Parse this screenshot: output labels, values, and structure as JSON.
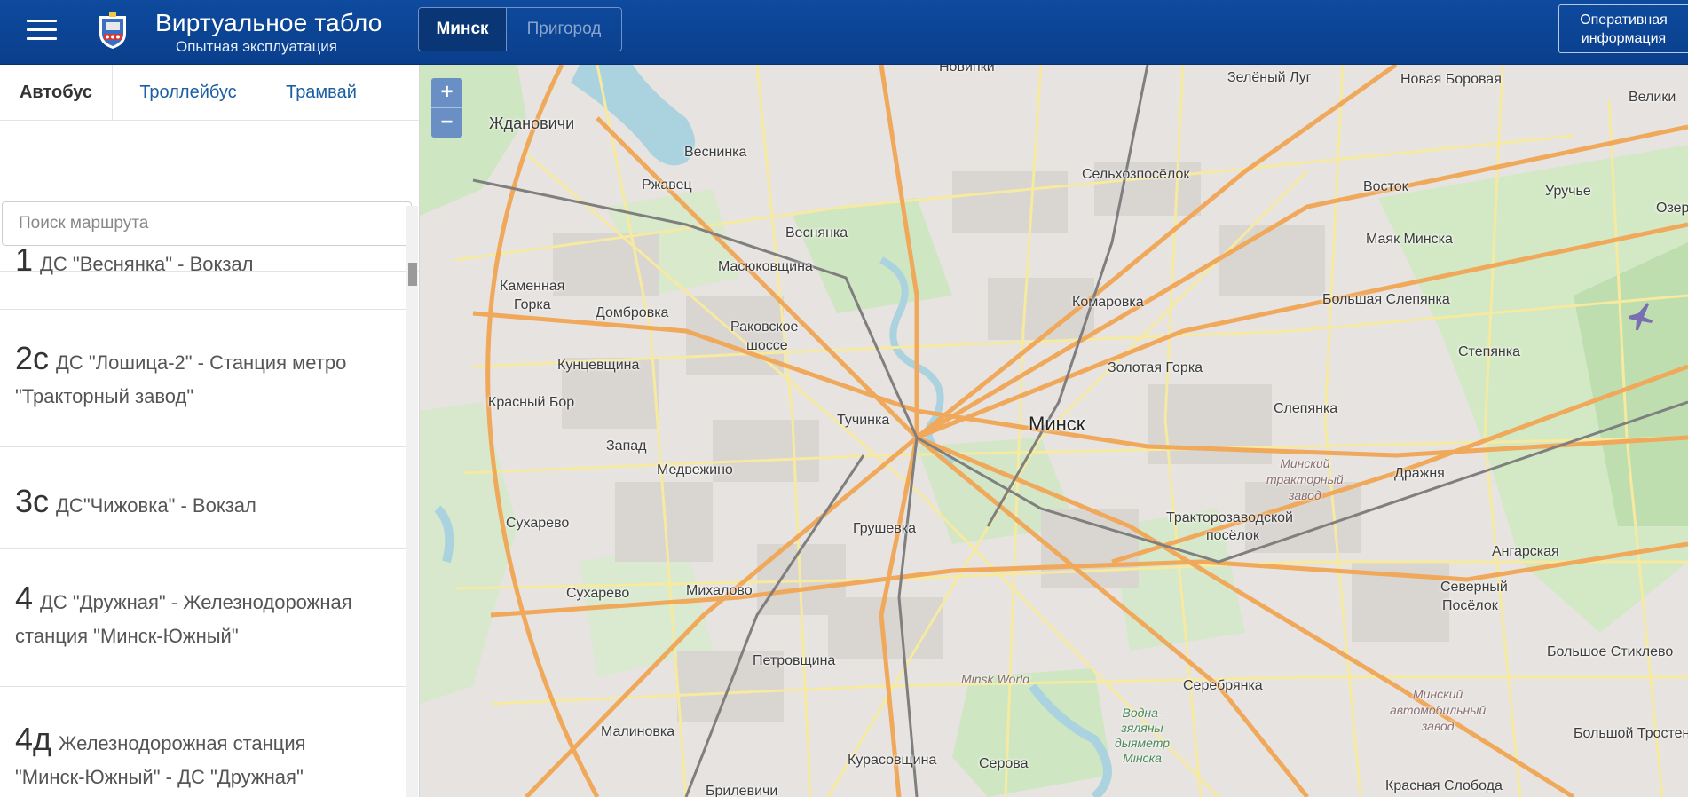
{
  "header": {
    "title": "Виртуальное табло",
    "subtitle": "Опытная эксплуатация",
    "city_tabs": [
      {
        "label": "Минск",
        "active": true
      },
      {
        "label": "Пригород",
        "active": false
      }
    ],
    "info_button": {
      "line1": "Оперативная",
      "line2": "информация"
    },
    "colors": {
      "header_bg": "#0e4a9e",
      "active_segment": "#0a3675"
    }
  },
  "transport_tabs": [
    {
      "label": "Автобус",
      "active": true
    },
    {
      "label": "Троллейбус",
      "active": false
    },
    {
      "label": "Трамвай",
      "active": false
    }
  ],
  "search": {
    "placeholder": "Поиск маршрута",
    "value": ""
  },
  "routes": [
    {
      "number": "1",
      "name": "ДС \"Веснянка\" - Вокзал"
    },
    {
      "number": "2с",
      "name_line1": "ДС \"Лошица-2\" - Станция метро",
      "name_line2": "\"Тракторный завод\""
    },
    {
      "number": "3с",
      "name": "ДС\"Чижовка\" - Вокзал"
    },
    {
      "number": "4",
      "name_line1": "ДС \"Дружная\" - Железнодорожная",
      "name_line2": "станция \"Минск-Южный\""
    },
    {
      "number": "4д",
      "name_line1": "Железнодорожная станция",
      "name_line2": "\"Минск-Южный\" - ДС \"Дружная\""
    }
  ],
  "map": {
    "zoom_in": "+",
    "zoom_out": "−",
    "labels": {
      "novinki": "Новинки",
      "zeleny_lug": "Зелёный Луг",
      "novaya_borovaya": "Новая Боровая",
      "velikiy": "Велики",
      "zhdanovichi": "Ждановичи",
      "vesninka": "Веснинка",
      "rzhavets": "Ржавец",
      "selkhozposelok": "Сельхозпосёлок",
      "vostok": "Восток",
      "uruchye": "Уручье",
      "ozer": "Озер",
      "vesnyanka": "Веснянка",
      "masyukovshchina": "Масюковщина",
      "mayak_minska": "Маяк Минска",
      "kamennaya_gorka_1": "Каменная",
      "kamennaya_gorka_2": "Горка",
      "dombrovka": "Домбровка",
      "komarovka": "Комаровка",
      "bolshaya_slepyanka": "Большая Слепянка",
      "rakovskoe_1": "Раковское",
      "rakovskoe_2": "шоссе",
      "stepyanka": "Степянка",
      "kuntsevshchina": "Кунцевщина",
      "zolotaya_gorka": "Золотая Горка",
      "krasny_bor": "Красный Бор",
      "tuchinka": "Тучинка",
      "minsk": "Минск",
      "slepyanka": "Слепянка",
      "zapad": "Запад",
      "minsk_tractor_1": "Минский",
      "minsk_tractor_2": "тракторный",
      "minsk_tractor_3": "завод",
      "medvezhino": "Медвежино",
      "drazhnya": "Дражня",
      "sukharevo_1": "Сухарево",
      "grushevka": "Грушевка",
      "traktorozavodskoy_1": "Тракторозаводской",
      "traktorozavodskoy_2": "посёлок",
      "angarskaya": "Ангарская",
      "sukharevo_2": "Сухарево",
      "mikhalovo": "Михалово",
      "severny_1": "Северный",
      "severny_2": "Посёлок",
      "petrovshchina": "Петровщина",
      "bolshoe_stiklevo": "Большое Стиклево",
      "minsk_world": "Minsk World",
      "serebryanka": "Серебрянка",
      "vodno_1": "Водна-",
      "vodno_2": "зяляны",
      "vodno_3": "дыяметр",
      "vodno_4": "Мінска",
      "minsk_auto_1": "Минский",
      "minsk_auto_2": "автомобильный",
      "minsk_auto_3": "завод",
      "malinovka": "Малиновка",
      "bolshoy_trostenets": "Большой Тростен",
      "kurasovshchina": "Курасовщина",
      "serova": "Серова",
      "krasnaya_sloboda": "Красная Слобода",
      "brilevichi": "Брилевичи"
    }
  }
}
